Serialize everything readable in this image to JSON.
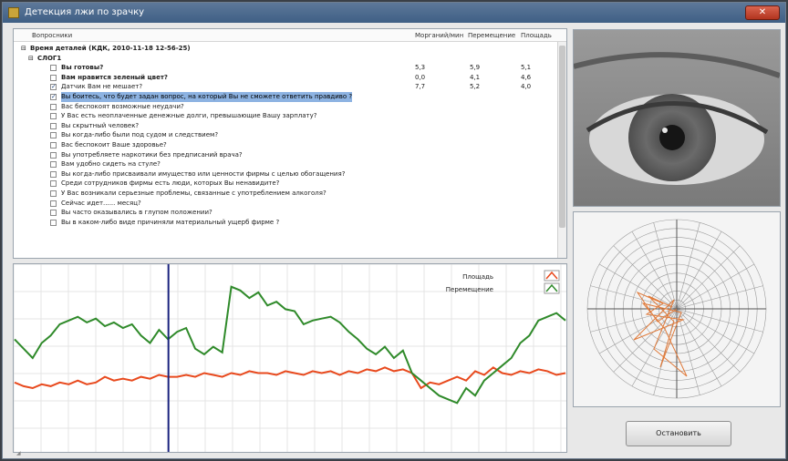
{
  "window": {
    "title": "Детекция лжи по зрачку",
    "close_label": "✕"
  },
  "questionnaire": {
    "columns": {
      "questions": "Вопросники",
      "blinks": "Морганий/мин",
      "movements": "Перемещение",
      "area": "Площадь"
    },
    "root": {
      "label": "Время деталей (КДК, 2010-11-18 12-56-25)"
    },
    "group": {
      "label": "СЛОГ1"
    },
    "items": [
      {
        "label": "Вы готовы?",
        "checked": false,
        "bold": true,
        "values": [
          "5,3",
          "5,9",
          "5,1"
        ]
      },
      {
        "label": "Вам нравится зеленый цвет?",
        "checked": false,
        "bold": true,
        "values": [
          "0,0",
          "4,1",
          "4,6"
        ]
      },
      {
        "label": "Датчик Вам не мешает?",
        "checked": true,
        "bold": false,
        "values": [
          "7,7",
          "5,2",
          "4,0"
        ]
      },
      {
        "label": "Вы боитесь, что будет задан вопрос, на который Вы не сможете ответить правдиво ?",
        "checked": true,
        "bold": false,
        "selected": true
      },
      {
        "label": "Вас беспокоят возможные неудачи?",
        "checked": false
      },
      {
        "label": "У Вас есть неоплаченные денежные долги, превышающие Вашу зарплату?",
        "checked": false
      },
      {
        "label": "Вы скрытный человек?",
        "checked": false
      },
      {
        "label": "Вы когда-либо были под судом и следствием?",
        "checked": false
      },
      {
        "label": "Вас беспокоит Ваше здоровье?",
        "checked": false
      },
      {
        "label": "Вы употребляете наркотики без предписаний врача?",
        "checked": false
      },
      {
        "label": "Вам удобно сидеть на стуле?",
        "checked": false
      },
      {
        "label": "Вы когда-либо присваивали имущество или ценности фирмы с целью обогащения?",
        "checked": false
      },
      {
        "label": "Среди сотрудников фирмы есть люди, которых Вы ненавидите?",
        "checked": false
      },
      {
        "label": "У Вас возникали серьезные проблемы, связанные с употреблением алкоголя?",
        "checked": false
      },
      {
        "label": "Сейчас идет...... месяц?",
        "checked": false
      },
      {
        "label": "Вы часто оказывались в глупом положении?",
        "checked": false
      },
      {
        "label": "Вы в каком-либо виде причиняли материальный ущерб фирме ?",
        "checked": false
      }
    ]
  },
  "graph": {
    "legend": [
      {
        "name": "Площадь",
        "color": "#e8491d"
      },
      {
        "name": "Перемещение",
        "color": "#2f8a2a"
      }
    ],
    "chart_data": {
      "type": "line",
      "cursor_x": 0.28,
      "series": [
        {
          "name": "Площадь",
          "values": [
            0.63,
            0.65,
            0.66,
            0.64,
            0.65,
            0.63,
            0.64,
            0.62,
            0.64,
            0.63,
            0.6,
            0.62,
            0.61,
            0.62,
            0.6,
            0.61,
            0.59,
            0.6,
            0.6,
            0.59,
            0.6,
            0.58,
            0.59,
            0.6,
            0.58,
            0.59,
            0.57,
            0.58,
            0.58,
            0.59,
            0.57,
            0.58,
            0.59,
            0.57,
            0.58,
            0.57,
            0.59,
            0.57,
            0.58,
            0.56,
            0.57,
            0.55,
            0.57,
            0.56,
            0.58,
            0.66,
            0.63,
            0.64,
            0.62,
            0.6,
            0.62,
            0.57,
            0.59,
            0.55,
            0.58,
            0.59,
            0.57,
            0.58,
            0.56,
            0.57,
            0.59,
            0.58
          ]
        },
        {
          "name": "Перемещение",
          "values": [
            0.4,
            0.45,
            0.5,
            0.42,
            0.38,
            0.32,
            0.3,
            0.28,
            0.31,
            0.29,
            0.33,
            0.31,
            0.34,
            0.32,
            0.38,
            0.42,
            0.35,
            0.4,
            0.36,
            0.34,
            0.45,
            0.48,
            0.44,
            0.47,
            0.12,
            0.14,
            0.18,
            0.15,
            0.22,
            0.2,
            0.24,
            0.25,
            0.32,
            0.3,
            0.29,
            0.28,
            0.31,
            0.36,
            0.4,
            0.45,
            0.48,
            0.44,
            0.5,
            0.46,
            0.58,
            0.62,
            0.66,
            0.7,
            0.72,
            0.74,
            0.66,
            0.7,
            0.62,
            0.58,
            0.54,
            0.5,
            0.42,
            0.38,
            0.3,
            0.28,
            0.26,
            0.3
          ]
        }
      ]
    }
  },
  "stop_button": {
    "label": "Остановить"
  }
}
